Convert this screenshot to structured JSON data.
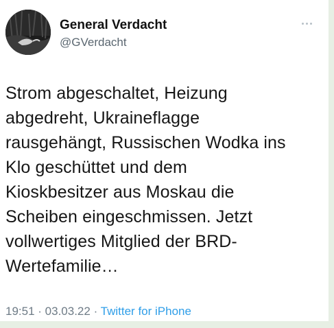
{
  "user": {
    "display_name": "General Verdacht",
    "handle": "@GVerdacht",
    "avatar_icon": "profile-photo-icon"
  },
  "tweet": {
    "lines": [
      "Strom abgeschaltet, Heizung",
      "abgedreht, Ukraineflagge",
      "rausgehängt, Russischen Wodka ins",
      "Klo geschüttet und dem",
      "Kioskbesitzer aus Moskau die",
      "Scheiben eingeschmissen. Jetzt",
      "vollwertiges Mitglied der BRD-",
      "Wertefamilie…"
    ]
  },
  "meta": {
    "time": "19:51",
    "separator": " · ",
    "date": "03.03.22",
    "source": "Twitter for iPhone"
  },
  "more_icon": "more-horizontal-icon",
  "colors": {
    "link": "#2f9ee8",
    "text": "#161616",
    "muted": "#6e7b86"
  }
}
